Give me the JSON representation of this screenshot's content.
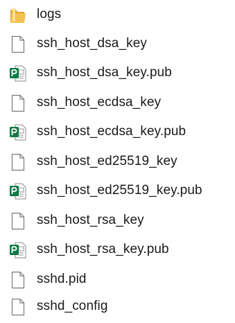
{
  "files": [
    {
      "name": "logs",
      "icon": "folder-icon"
    },
    {
      "name": "ssh_host_dsa_key",
      "icon": "file-icon"
    },
    {
      "name": "ssh_host_dsa_key.pub",
      "icon": "publisher-file-icon"
    },
    {
      "name": "ssh_host_ecdsa_key",
      "icon": "file-icon"
    },
    {
      "name": "ssh_host_ecdsa_key.pub",
      "icon": "publisher-file-icon"
    },
    {
      "name": "ssh_host_ed25519_key",
      "icon": "file-icon"
    },
    {
      "name": "ssh_host_ed25519_key.pub",
      "icon": "publisher-file-icon"
    },
    {
      "name": "ssh_host_rsa_key",
      "icon": "file-icon"
    },
    {
      "name": "ssh_host_rsa_key.pub",
      "icon": "publisher-file-icon"
    },
    {
      "name": "sshd.pid",
      "icon": "file-icon"
    },
    {
      "name": "sshd_config",
      "icon": "file-icon"
    }
  ],
  "colors": {
    "folder": "#F2C14E",
    "publisher_green": "#0E7B47",
    "file_outline": "#7A7A7A"
  }
}
